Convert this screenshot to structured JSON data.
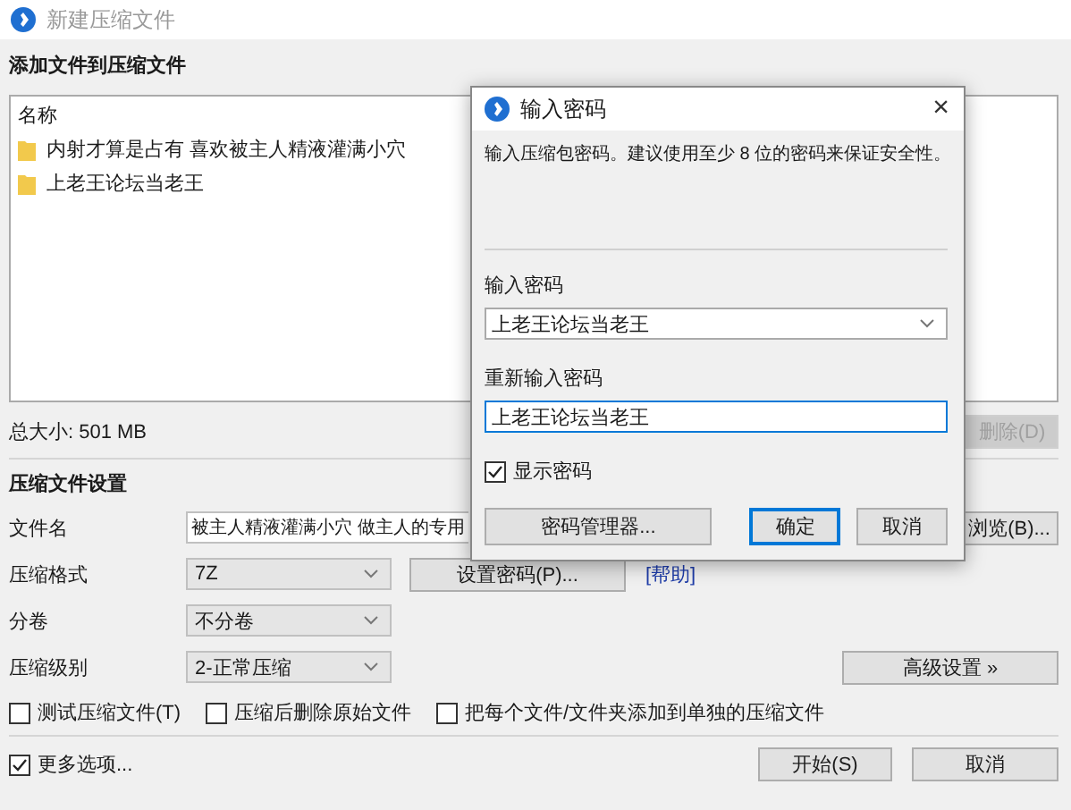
{
  "window": {
    "title": "新建压缩文件"
  },
  "files_section": {
    "heading": "添加文件到压缩文件",
    "column": "名称",
    "files": [
      {
        "name": "内射才算是占有 喜欢被主人精液灌满小穴"
      },
      {
        "name": "上老王论坛当老王"
      }
    ],
    "total_size": "总大小: 501 MB",
    "delete_button": {
      "label": "删除(D)",
      "disabled": true
    }
  },
  "settings": {
    "heading": "压缩文件设置",
    "fields": [
      {
        "kind": "text",
        "label": "文件名",
        "value": "被主人精液灌满小穴 做主人的专用",
        "button": "浏览(B)..."
      },
      {
        "kind": "select",
        "label": "压缩格式",
        "value": "7Z",
        "button": "设置密码(P)...",
        "link": "[帮助]"
      },
      {
        "kind": "select",
        "label": "分卷",
        "value": "不分卷"
      },
      {
        "kind": "select",
        "label": "压缩级别",
        "value": "2-正常压缩",
        "button": "高级设置 »"
      }
    ],
    "options": [
      {
        "label": "测试压缩文件(T)",
        "checked": false
      },
      {
        "label": "压缩后删除原始文件",
        "checked": false
      },
      {
        "label": "把每个文件/文件夹添加到单独的压缩文件",
        "checked": false
      }
    ]
  },
  "footer": {
    "more_options": {
      "label": "更多选项...",
      "checked": true
    },
    "buttons": [
      {
        "label": "开始(S)"
      },
      {
        "label": "取消"
      }
    ]
  },
  "dialog": {
    "title": "输入密码",
    "close": "×",
    "message": "输入压缩包密码。建议使用至少 8 位的密码来保证安全性。",
    "password_label": "输入密码",
    "password": "上老王论坛当老王",
    "confirm_label": "重新输入密码",
    "confirm": "上老王论坛当老王",
    "show_password": {
      "label": "显示密码",
      "checked": true
    },
    "buttons": [
      {
        "label": "密码管理器...",
        "default": false
      },
      {
        "label": "确定",
        "default": true
      },
      {
        "label": "取消",
        "default": false
      }
    ]
  }
}
